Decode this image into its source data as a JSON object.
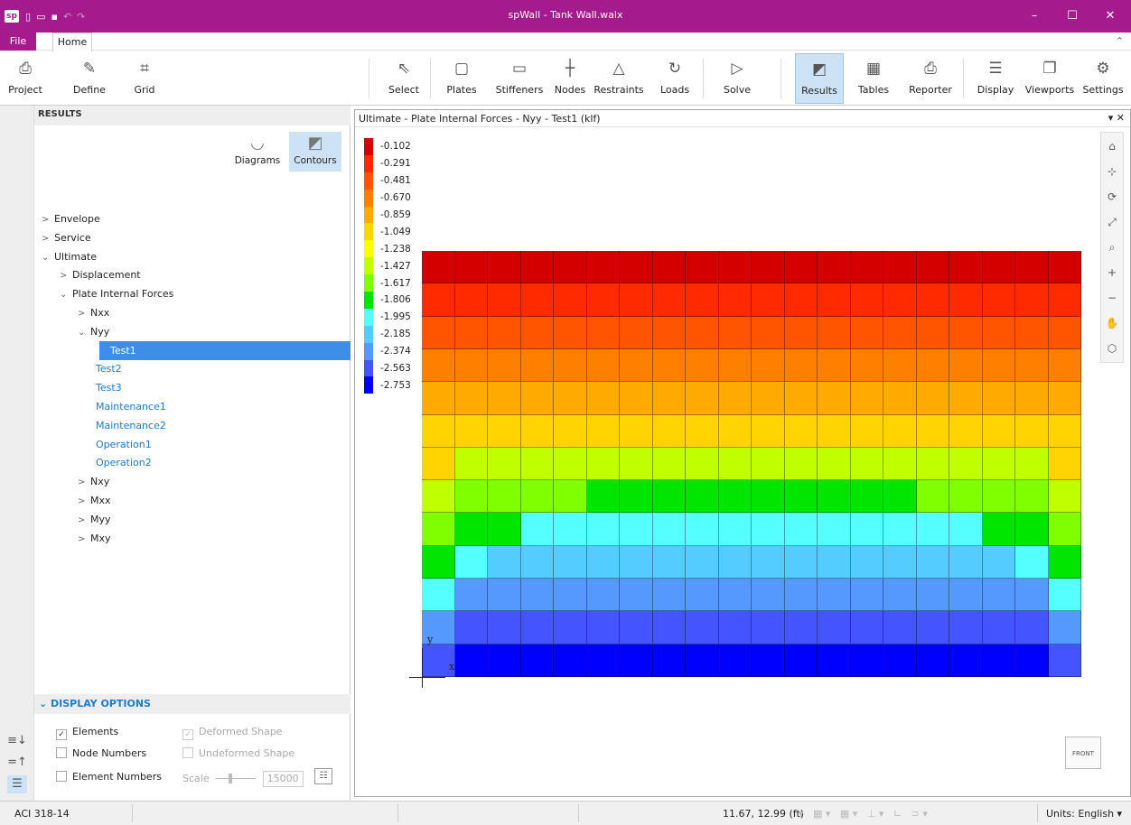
{
  "window": {
    "title": "spWall - Tank Wall.walx",
    "logo": "sp",
    "minimize": "–",
    "maximize": "☐",
    "close": "✕"
  },
  "tabs": {
    "file": "File",
    "home": "Home"
  },
  "ribbon": [
    {
      "label": "Project",
      "icon": "project-icon",
      "glyph": "⎙"
    },
    {
      "label": "Define",
      "icon": "define-icon",
      "glyph": "✎"
    },
    {
      "label": "Grid",
      "icon": "grid-icon",
      "glyph": "⌗"
    },
    {
      "label": "Select",
      "icon": "select-icon",
      "glyph": "⇖"
    },
    {
      "label": "Plates",
      "icon": "plates-icon",
      "glyph": "▢"
    },
    {
      "label": "Stiffeners",
      "icon": "stiffeners-icon",
      "glyph": "▭"
    },
    {
      "label": "Nodes",
      "icon": "nodes-icon",
      "glyph": "┼"
    },
    {
      "label": "Restraints",
      "icon": "restraints-icon",
      "glyph": "△"
    },
    {
      "label": "Loads",
      "icon": "loads-icon",
      "glyph": "↻"
    },
    {
      "label": "Solve",
      "icon": "solve-icon",
      "glyph": "▷"
    },
    {
      "label": "Results",
      "icon": "results-icon",
      "glyph": "◩"
    },
    {
      "label": "Tables",
      "icon": "tables-icon",
      "glyph": "▦"
    },
    {
      "label": "Reporter",
      "icon": "reporter-icon",
      "glyph": "⎙"
    },
    {
      "label": "Display",
      "icon": "display-icon",
      "glyph": "☰"
    },
    {
      "label": "Viewports",
      "icon": "viewports-icon",
      "glyph": "❐"
    },
    {
      "label": "Settings",
      "icon": "settings-icon",
      "glyph": "⚙"
    }
  ],
  "panel": {
    "title": "RESULTS",
    "diagrams": "Diagrams",
    "contours": "Contours",
    "tree": [
      {
        "label": "Envelope",
        "chevron": ">",
        "level": 0
      },
      {
        "label": "Service",
        "chevron": ">",
        "level": 0
      },
      {
        "label": "Ultimate",
        "chevron": "⌄",
        "level": 0
      },
      {
        "label": "Displacement",
        "chevron": ">",
        "level": 1
      },
      {
        "label": "Plate Internal Forces",
        "chevron": "⌄",
        "level": 1
      },
      {
        "label": "Nxx",
        "chevron": ">",
        "level": 2
      },
      {
        "label": "Nyy",
        "chevron": "⌄",
        "level": 2
      },
      {
        "label": "Test1",
        "chevron": "",
        "level": 3,
        "selected": true
      },
      {
        "label": "Test2",
        "chevron": "",
        "level": 3
      },
      {
        "label": "Test3",
        "chevron": "",
        "level": 3
      },
      {
        "label": "Maintenance1",
        "chevron": "",
        "level": 3
      },
      {
        "label": "Maintenance2",
        "chevron": "",
        "level": 3
      },
      {
        "label": "Operation1",
        "chevron": "",
        "level": 3
      },
      {
        "label": "Operation2",
        "chevron": "",
        "level": 3
      },
      {
        "label": "Nxy",
        "chevron": ">",
        "level": 2
      },
      {
        "label": "Mxx",
        "chevron": ">",
        "level": 2
      },
      {
        "label": "Myy",
        "chevron": ">",
        "level": 2
      },
      {
        "label": "Mxy",
        "chevron": ">",
        "level": 2
      }
    ],
    "display_options": {
      "title": "DISPLAY OPTIONS",
      "elements": "Elements",
      "node_numbers": "Node Numbers",
      "element_numbers": "Element Numbers",
      "deformed_shape": "Deformed Shape",
      "undeformed_shape": "Undeformed Shape",
      "scale_label": "Scale",
      "scale_value": "15000"
    }
  },
  "viewport": {
    "title": "Ultimate - Plate Internal Forces - Nyy - Test1 (klf)",
    "axis_y": "y",
    "axis_x": "x",
    "cube": "FRONT",
    "legend": [
      {
        "value": "-0.102",
        "color": "#d40000"
      },
      {
        "value": "-0.291",
        "color": "#ff2a00"
      },
      {
        "value": "-0.481",
        "color": "#ff5500"
      },
      {
        "value": "-0.670",
        "color": "#ff8000"
      },
      {
        "value": "-0.859",
        "color": "#ffaa00"
      },
      {
        "value": "-1.049",
        "color": "#ffd400"
      },
      {
        "value": "-1.238",
        "color": "#ffff00"
      },
      {
        "value": "-1.427",
        "color": "#bfff00"
      },
      {
        "value": "-1.617",
        "color": "#80ff00"
      },
      {
        "value": "-1.806",
        "color": "#00e600"
      },
      {
        "value": "-1.995",
        "color": "#55ffff"
      },
      {
        "value": "-2.185",
        "color": "#55ccff"
      },
      {
        "value": "-2.374",
        "color": "#5599ff"
      },
      {
        "value": "-2.563",
        "color": "#4455ff"
      },
      {
        "value": "-2.753",
        "color": "#0000ff"
      }
    ],
    "contour_rows": [
      "aaaaaaaaaaaaaaaaaaaa",
      "bbbbbbbbbbbbbbbbbbbb",
      "cccccccccccccccccccc",
      "dddddddddddddddddddd",
      "eeeeeeeeeeeeeeeeeeee",
      "ffffffffffffffffffff",
      "fhhhhhhhhhhhhhhhhhhf",
      "hiiiijjjjjjjjjjiiiih",
      "ijjkkkkkkkkkkkkkkjji",
      "jkllllllllllllllllkj",
      "kmmmmmmmmmmmmmmmmmmk",
      "mnnnnnnnnnnnnnnnnnnm",
      "noooooooooooooooooon"
    ]
  },
  "vtools": [
    {
      "icon": "home-view-icon",
      "glyph": "⌂"
    },
    {
      "icon": "axes-icon",
      "glyph": "⊹"
    },
    {
      "icon": "rotate-icon",
      "glyph": "⟳"
    },
    {
      "icon": "zoom-extents-icon",
      "glyph": "⤢"
    },
    {
      "icon": "zoom-window-icon",
      "glyph": "⌕"
    },
    {
      "icon": "zoom-in-icon",
      "glyph": "+"
    },
    {
      "icon": "zoom-out-icon",
      "glyph": "−"
    },
    {
      "icon": "pan-icon",
      "glyph": "✋"
    },
    {
      "icon": "view-cube-icon",
      "glyph": "⬡"
    }
  ],
  "status": {
    "code": "ACI 318-14",
    "coords": "11.67, 12.99 (ft)",
    "units": "Units: English"
  }
}
